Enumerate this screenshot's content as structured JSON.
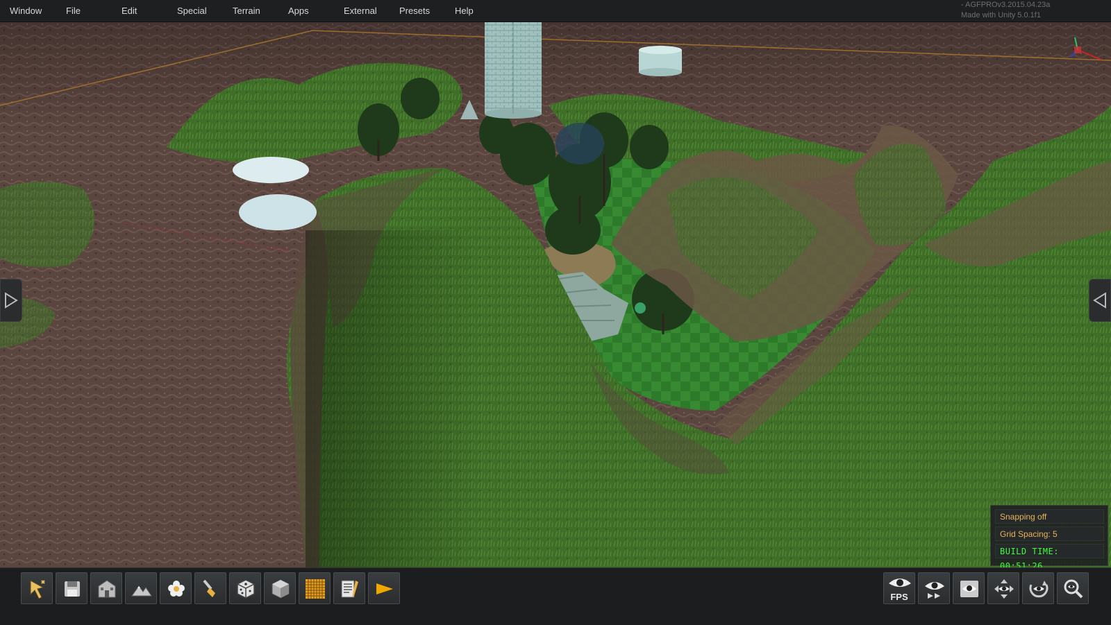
{
  "menu": {
    "items": [
      "Window",
      "File",
      "Edit",
      "Special",
      "Terrain",
      "Apps",
      "External",
      "Presets",
      "Help"
    ]
  },
  "version": {
    "line1": "- AGFPROv3.2015.04.23a",
    "line2": "Made with Unity 5.0.1f1"
  },
  "status": {
    "snapping": "Snapping off",
    "grid_spacing": "Grid Spacing: 5",
    "build_time": "BUILD TIME: 00:51:26"
  },
  "toolbar": {
    "left_tools": [
      "select-tool-icon",
      "save-icon",
      "building-icon",
      "terrain-icon",
      "flower-icon",
      "paint-brush-icon",
      "dice-cube-icon",
      "cube-icon",
      "grid-icon",
      "notes-icon",
      "play-icon"
    ],
    "right_tools": [
      "fps-eye-icon",
      "fly-camera-icon",
      "camera-settings-icon",
      "move-camera-icon",
      "orbit-camera-icon",
      "zoom-icon"
    ],
    "fps_label": "FPS"
  },
  "colors": {
    "menu_bg": "#1d1f20",
    "status_orange": "#e8b45a",
    "build_time_green": "#3cff3c",
    "play_arrow": "#f0a800"
  }
}
